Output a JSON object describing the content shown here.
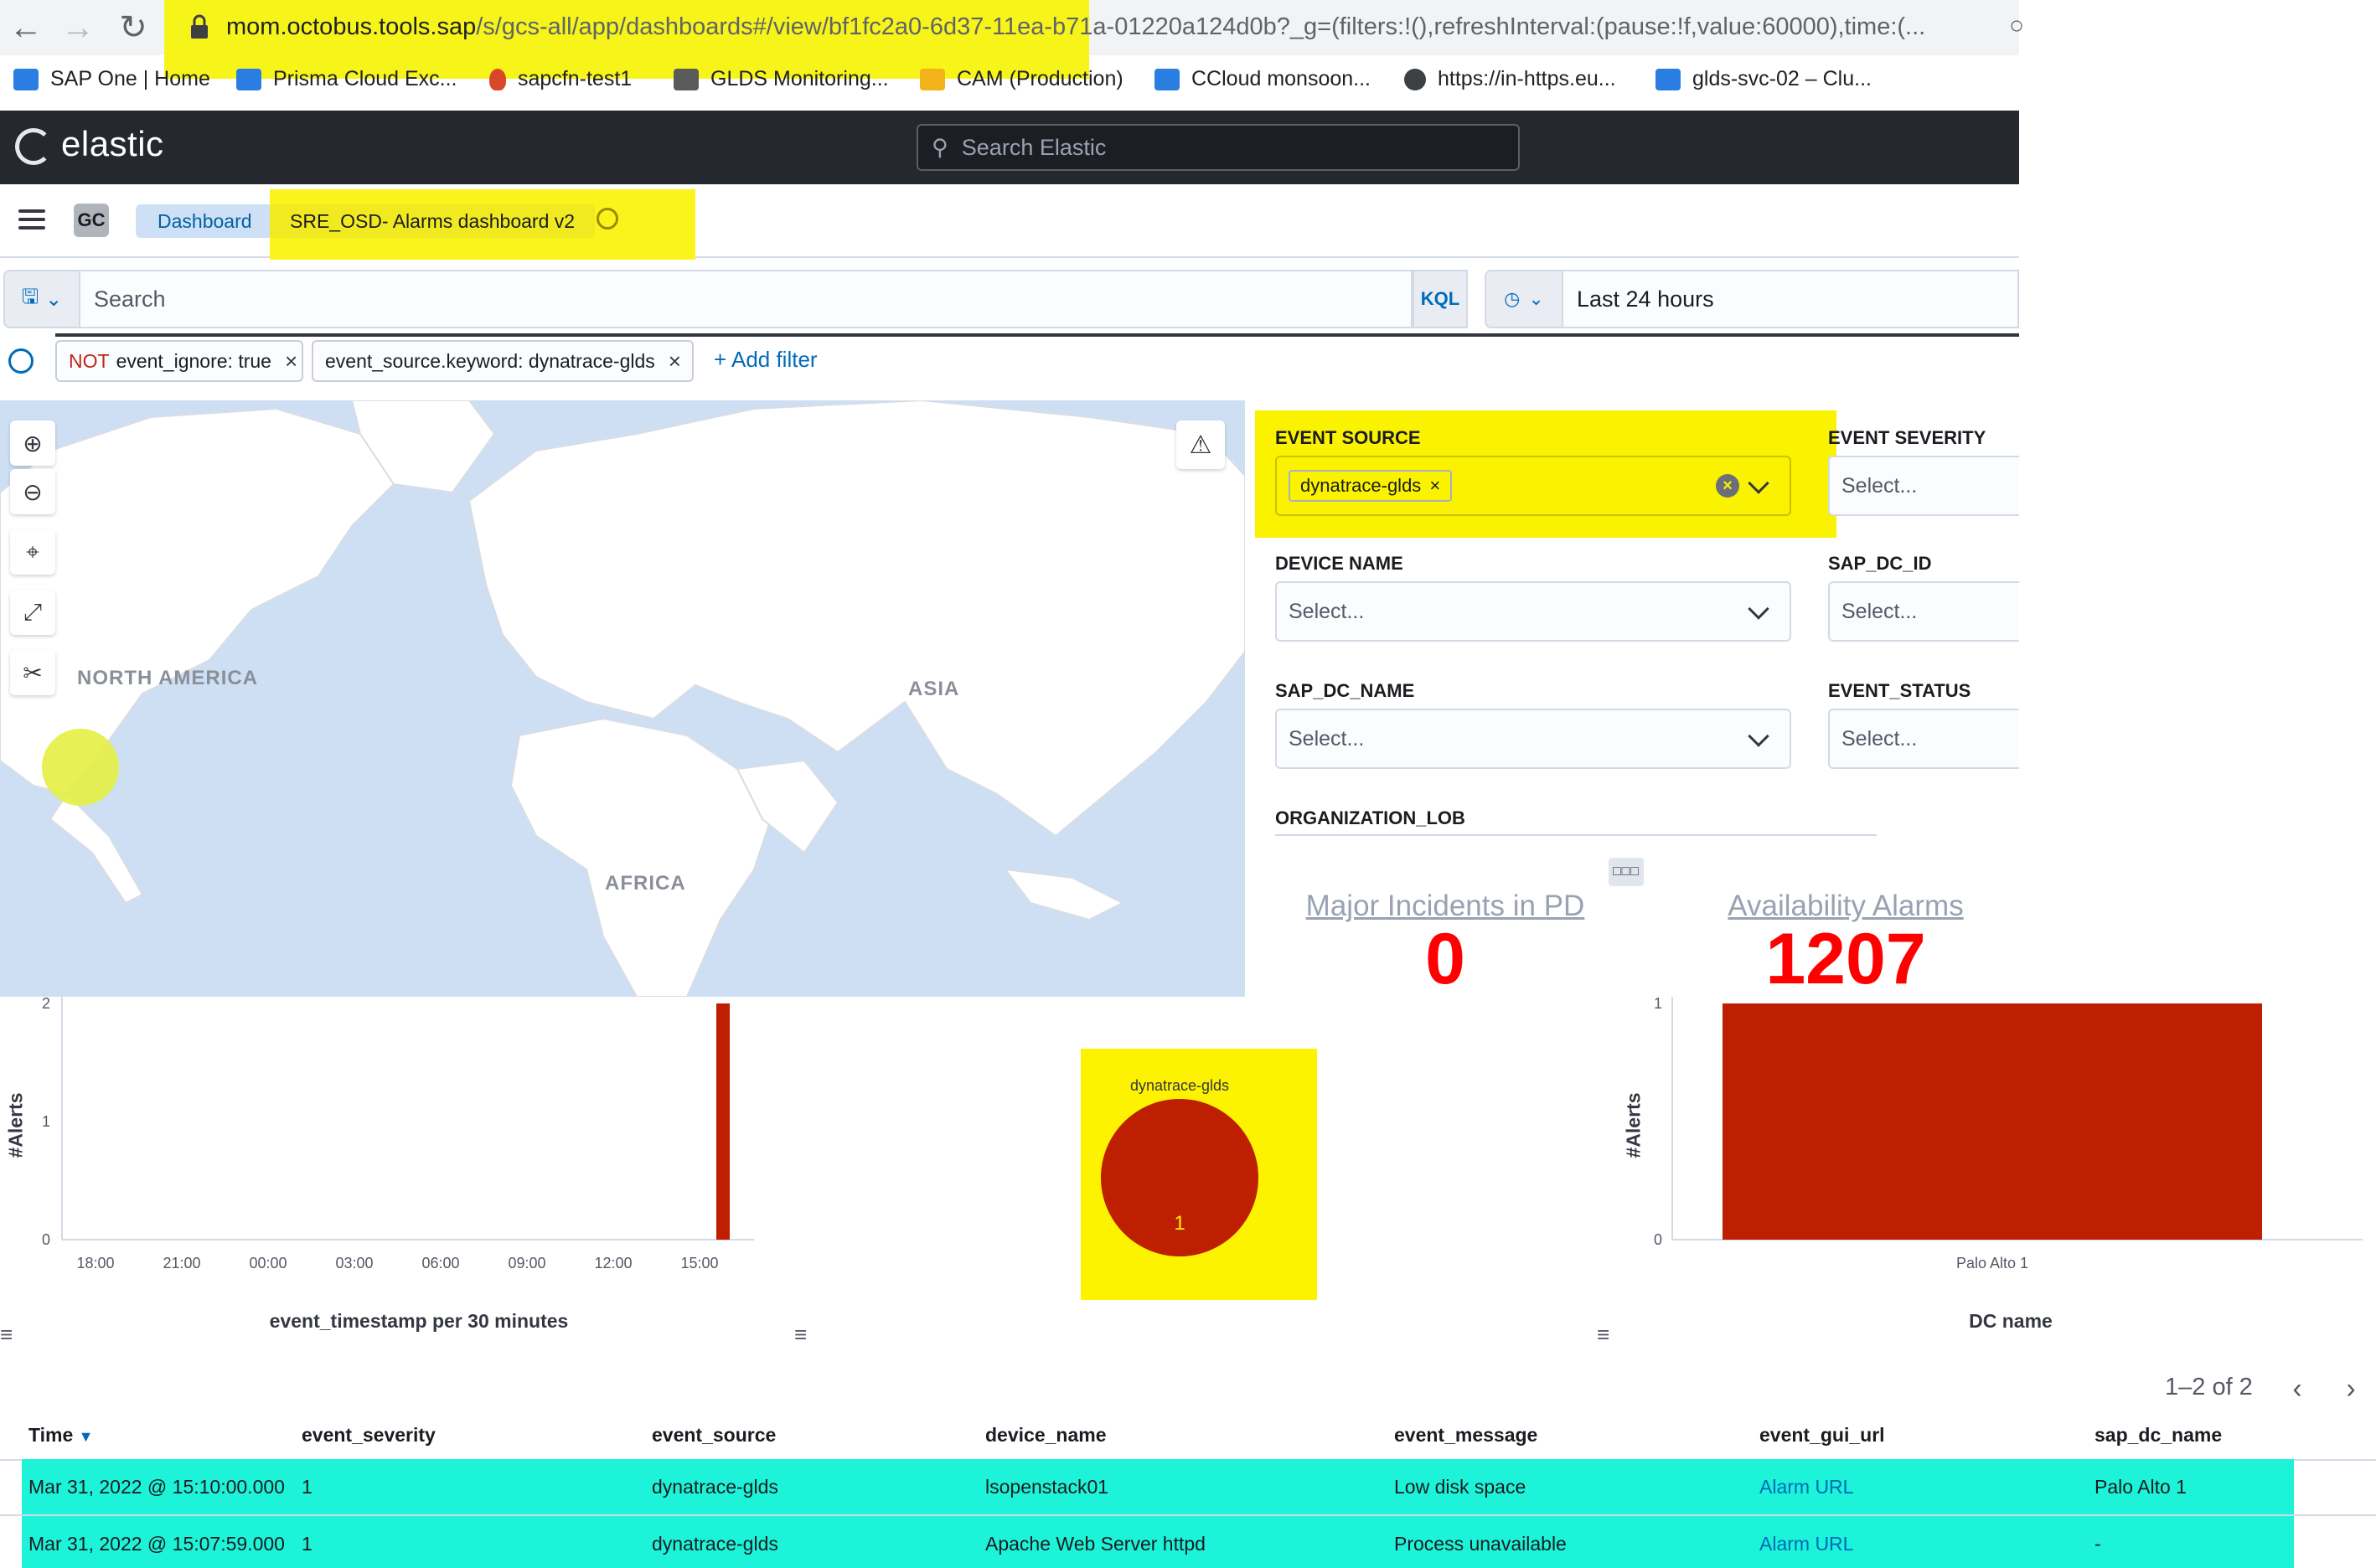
{
  "browser": {
    "url_host": "mom.octobus.tools.sap",
    "url_path": "/s/gcs-all/app/dashboards#/view/bf1fc2a0-6d37-11ea-b71a-01220a124d0b?_g=(filters:!(),refreshInterval:(pause:!f,value:60000),time:(...",
    "bookmarks": [
      {
        "label": "SAP One | Home",
        "icon": "sap-globe-icon",
        "color": "#2a7de1"
      },
      {
        "label": "Prisma Cloud Exc...",
        "icon": "sap-logo-icon",
        "color": "#2a7de1"
      },
      {
        "label": "sapcfn-test1",
        "icon": "flame-icon",
        "color": "#d9472b"
      },
      {
        "label": "GLDS Monitoring...",
        "icon": "monitor-icon",
        "color": "#5a5a5a"
      },
      {
        "label": "CAM (Production)",
        "icon": "folder-icon",
        "color": "#f2b21a"
      },
      {
        "label": "CCloud monsoon...",
        "icon": "sap-logo-icon",
        "color": "#2a7de1"
      },
      {
        "label": "https://in-https.eu...",
        "icon": "globe-icon",
        "color": "#3c4043"
      },
      {
        "label": "glds-svc-02 – Clu...",
        "icon": "sap-logo-icon",
        "color": "#2a7de1"
      }
    ]
  },
  "header": {
    "logo_text": "elastic",
    "search_placeholder": "Search Elastic"
  },
  "breadcrumb": {
    "avatar": "GC",
    "dashboard": "Dashboard",
    "title": "SRE_OSD- Alarms dashboard v2"
  },
  "query": {
    "placeholder": "Search",
    "language": "KQL",
    "time_range": "Last 24 hours"
  },
  "filters": [
    {
      "prefix": "NOT",
      "label": "event_ignore: true"
    },
    {
      "prefix": "",
      "label": "event_source.keyword: dynatrace-glds"
    }
  ],
  "add_filter": "+ Add filter",
  "map": {
    "labels": {
      "north_america": "NORTH AMERICA",
      "asia": "ASIA",
      "africa": "AFRICA"
    },
    "colors": {
      "water": "#cedff3",
      "land": "#ffffff",
      "point": "#e4ef44"
    }
  },
  "controls": {
    "event_source": {
      "label": "EVENT SOURCE",
      "selected": "dynatrace-glds"
    },
    "event_severity": {
      "label": "EVENT SEVERITY",
      "placeholder": "Select..."
    },
    "device_name": {
      "label": "DEVICE NAME",
      "placeholder": "Select..."
    },
    "sap_dc_id": {
      "label": "SAP_DC_ID",
      "placeholder": "Select..."
    },
    "sap_dc_name": {
      "label": "SAP_DC_NAME",
      "placeholder": "Select..."
    },
    "event_status": {
      "label": "EVENT_STATUS",
      "placeholder": "Select..."
    },
    "organization_lob": {
      "label": "ORGANIZATION_LOB"
    }
  },
  "metrics": {
    "major_incidents": {
      "title": "Major Incidents in PD",
      "value": "0"
    },
    "availability_alarms": {
      "title": "Availability Alarms",
      "value": "1207"
    }
  },
  "chart_data": [
    {
      "type": "bar",
      "ylabel": "#Alerts",
      "xlabel": "event_timestamp per 30 minutes",
      "ylim": [
        0,
        2
      ],
      "yticks": [
        "0",
        "1",
        "2"
      ],
      "xticks": [
        "18:00",
        "21:00",
        "00:00",
        "03:00",
        "06:00",
        "09:00",
        "12:00",
        "15:00"
      ],
      "bars": [
        {
          "x": "15:00",
          "value": 2
        }
      ],
      "color": "#bd1f00"
    },
    {
      "type": "pie",
      "slices": [
        {
          "label": "dynatrace-glds",
          "value": 1
        }
      ],
      "color": "#bd1f00"
    },
    {
      "type": "bar",
      "ylabel": "#Alerts",
      "xlabel": "DC name",
      "ylim": [
        0,
        1
      ],
      "yticks": [
        "0",
        "1"
      ],
      "categories": [
        "Palo Alto 1"
      ],
      "values": [
        1
      ],
      "color": "#bd1f00"
    }
  ],
  "table": {
    "pagination": "1–2 of 2",
    "columns": [
      "Time",
      "event_severity",
      "event_source",
      "device_name",
      "event_message",
      "event_gui_url",
      "sap_dc_name"
    ],
    "rows": [
      [
        "Mar 31, 2022 @ 15:10:00.000",
        "1",
        "dynatrace-glds",
        "lsopenstack01",
        "Low disk space",
        "Alarm URL",
        "Palo Alto 1"
      ],
      [
        "Mar 31, 2022 @ 15:07:59.000",
        "1",
        "dynatrace-glds",
        "Apache Web Server httpd",
        "Process unavailable",
        "Alarm URL",
        "-"
      ]
    ]
  }
}
